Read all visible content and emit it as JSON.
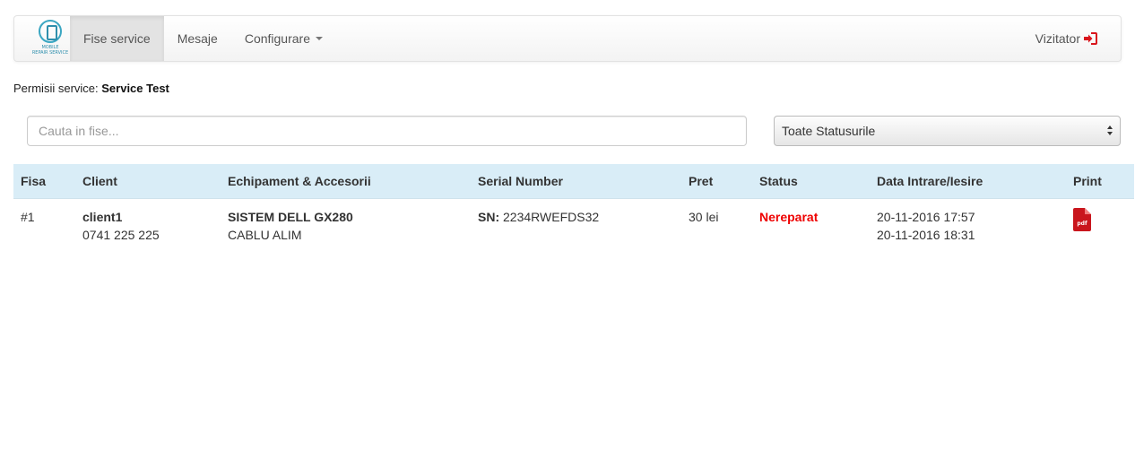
{
  "brand": {
    "logo_text_line1": "MOBILE",
    "logo_text_line2": "REPAIR SERVICE"
  },
  "nav": {
    "items": [
      {
        "label": "Fise service",
        "active": true
      },
      {
        "label": "Mesaje",
        "active": false
      },
      {
        "label": "Configurare",
        "active": false
      }
    ],
    "user_label": "Vizitator"
  },
  "permissions": {
    "label": "Permisii service:",
    "value": "Service Test"
  },
  "search": {
    "placeholder": "Cauta in fise...",
    "value": ""
  },
  "status_filter": {
    "selected": "Toate Statusurile"
  },
  "table": {
    "columns": [
      "Fisa",
      "Client",
      "Echipament & Accesorii",
      "Serial Number",
      "Pret",
      "Status",
      "Data Intrare/Iesire",
      "Print"
    ],
    "rows": [
      {
        "fisa": "#1",
        "client_name": "client1",
        "client_phone": "0741 225 225",
        "equipment": "SISTEM DELL GX280",
        "accessories": "CABLU ALIM",
        "serial_label": "SN:",
        "serial_value": "2234RWEFDS32",
        "price": "30 lei",
        "status": "Nereparat",
        "date_in": "20-11-2016 17:57",
        "date_out": "20-11-2016 18:31",
        "print_icon_text": "pdf"
      }
    ]
  },
  "colors": {
    "header_row_bg": "#d9edf7",
    "status_red": "#e00000",
    "logout_red": "#d9161d",
    "pdf_red": "#c9161d",
    "brand_teal": "#3aa6c2"
  }
}
